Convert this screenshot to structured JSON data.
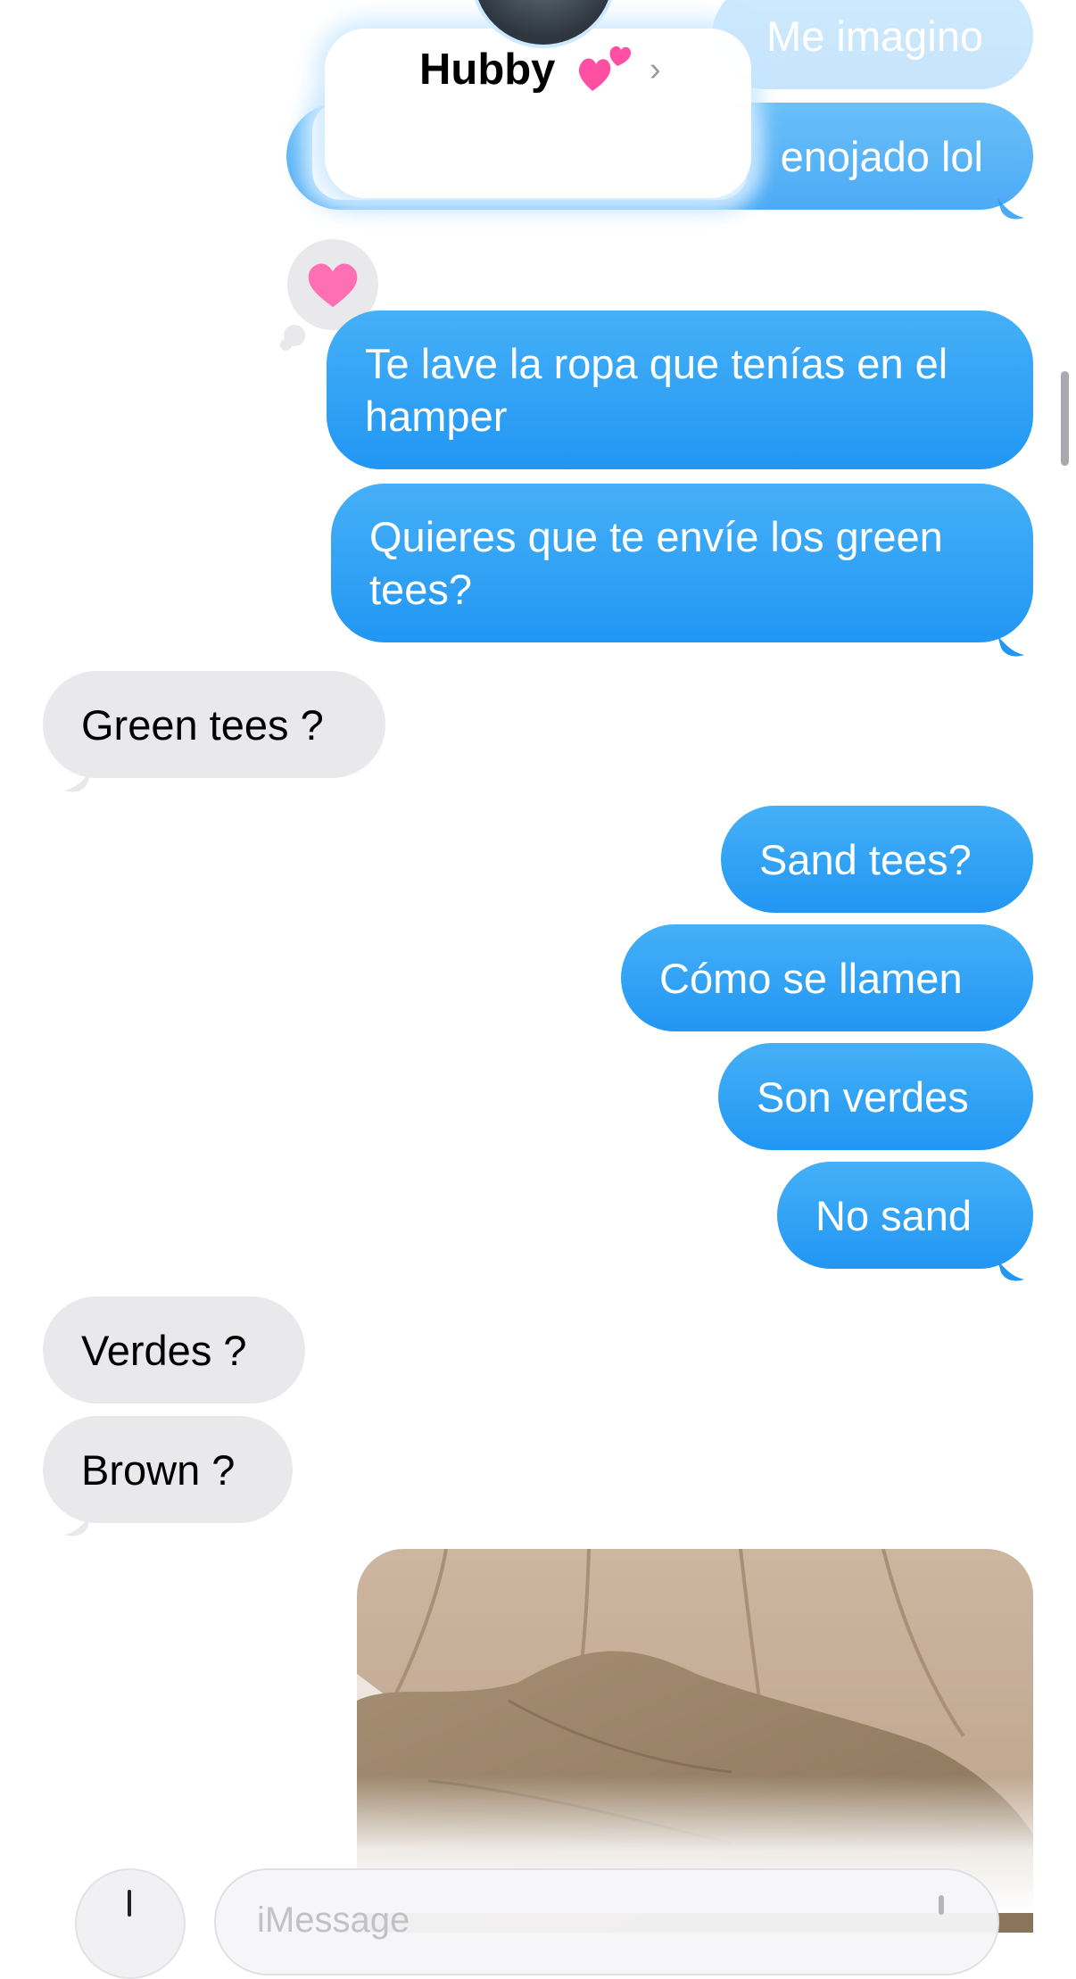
{
  "header": {
    "contact_name": "Hubby",
    "chevron": "›"
  },
  "messages": {
    "m0": "Me imagino",
    "m1": "enojado lol",
    "m2": "Te lave la ropa que tenías en el\nhamper",
    "m3": "Quieres que te envíe los green\ntees?",
    "m4": "Green tees ?",
    "m5": "Sand tees?",
    "m6": "Cómo se llamen",
    "m7": "Son verdes",
    "m8": "No sand",
    "m9": "Verdes ?",
    "m10": "Brown ?"
  },
  "composer": {
    "placeholder": "iMessage"
  },
  "colors": {
    "outgoing": "#2196f3",
    "incoming": "#e9e9eb",
    "heart": "#ff6fb3"
  },
  "icons": [
    "heart-tapback-icon",
    "two-hearts-emoji-icon",
    "chevron-right-icon",
    "plus-icon",
    "microphone-icon"
  ]
}
